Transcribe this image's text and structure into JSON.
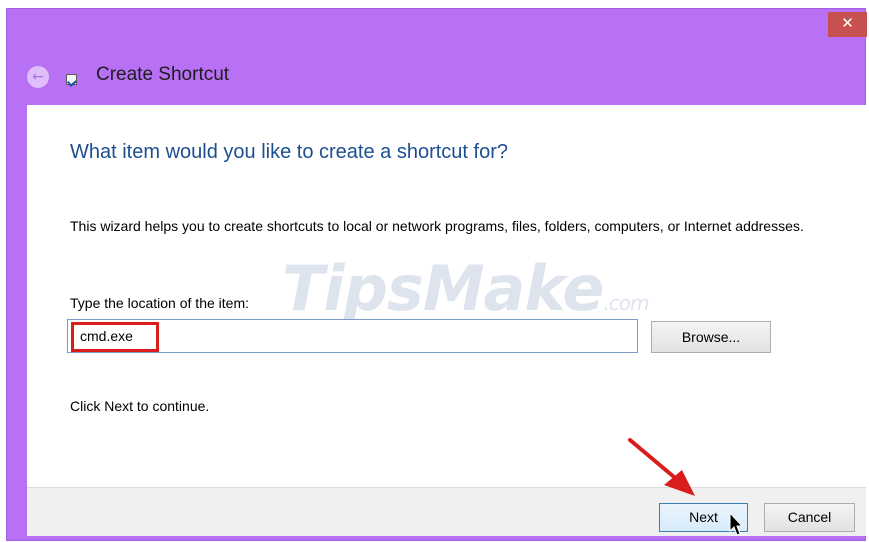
{
  "window": {
    "title": "Create Shortcut",
    "close_glyph": "✕",
    "back_glyph": "←",
    "title_bar_color": "#b870f4"
  },
  "wizard": {
    "heading": "What item would you like to create a shortcut for?",
    "description": "This wizard helps you to create shortcuts to local or network programs, files, folders, computers, or Internet addresses.",
    "location_label": "Type the location of the item:",
    "location_value": "cmd.exe",
    "browse_label": "Browse...",
    "continue_text": "Click Next to continue."
  },
  "footer": {
    "next_label": "Next",
    "cancel_label": "Cancel"
  },
  "watermark": {
    "text": "TipsMake",
    "suffix": ".com"
  },
  "annotation_color": "#d91c1c"
}
